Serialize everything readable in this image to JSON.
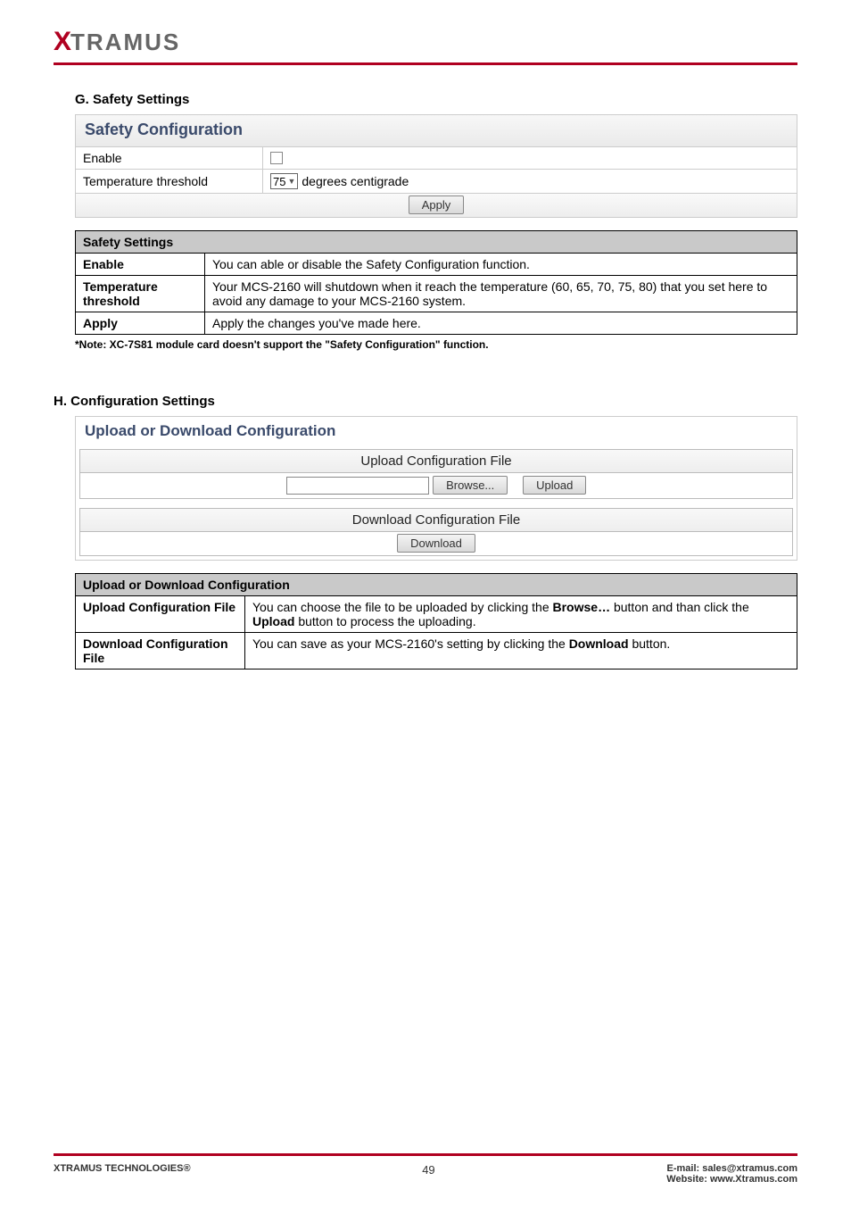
{
  "header": {
    "logo_x": "X",
    "logo_rest": "TRAMUS"
  },
  "section_g": {
    "title": "G. Safety Settings",
    "panel_title": "Safety Configuration",
    "enable_label": "Enable",
    "temp_label": "Temperature threshold",
    "temp_value": "75",
    "temp_suffix": "degrees centigrade",
    "apply_label": "Apply",
    "spec_header": "Safety Settings",
    "rows": {
      "enable": {
        "label": "Enable",
        "desc": "You can able or disable the Safety Configuration function."
      },
      "temp": {
        "label": "Temperature threshold",
        "desc": "Your MCS-2160 will shutdown when it reach the temperature (60, 65, 70, 75, 80) that you set here to avoid any damage to your MCS-2160 system."
      },
      "apply": {
        "label": "Apply",
        "desc": "Apply the changes you've made here."
      }
    },
    "note": "*Note: XC-7S81 module card doesn't support the \"Safety Configuration\" function."
  },
  "section_h": {
    "title": "H. Configuration Settings",
    "panel_title": "Upload or Download Configuration",
    "upload_header": "Upload Configuration File",
    "browse_label": "Browse...",
    "upload_btn": "Upload",
    "download_header": "Download Configuration File",
    "download_btn": "Download",
    "spec_header": "Upload or Download Configuration",
    "rows": {
      "upload": {
        "label": "Upload Configuration File",
        "pre": "You can choose the file to be uploaded by clicking the ",
        "b1": "Browse…",
        "mid": " button and than click the ",
        "b2": "Upload",
        "post": " button to process the uploading."
      },
      "download": {
        "label": "Download Configuration File",
        "pre": "You can save as your MCS-2160's setting by clicking the ",
        "b1": "Download",
        "post": " button."
      }
    }
  },
  "footer": {
    "left": "XTRAMUS TECHNOLOGIES®",
    "center": "49",
    "right1": "E-mail: sales@xtramus.com",
    "right2": "Website:  www.Xtramus.com"
  }
}
